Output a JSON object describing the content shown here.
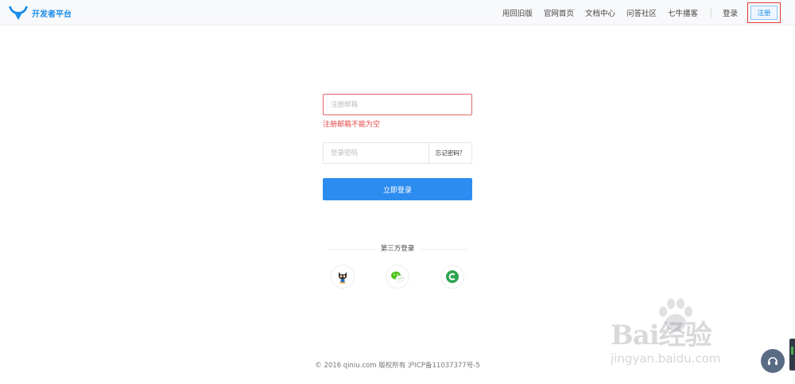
{
  "header": {
    "logo_text": "开发者平台",
    "nav": [
      {
        "label": "用回旧版"
      },
      {
        "label": "官网首页"
      },
      {
        "label": "文档中心"
      },
      {
        "label": "问答社区"
      },
      {
        "label": "七牛播客"
      }
    ],
    "login_label": "登录",
    "register_label": "注册"
  },
  "form": {
    "email_placeholder": "注册邮箱",
    "email_value": "",
    "email_error": "注册邮箱不能为空",
    "password_placeholder": "登录密码",
    "forgot_label": "忘记密码？",
    "submit_label": "立即登录"
  },
  "third_party": {
    "title": "第三方登录",
    "providers": [
      {
        "icon": "github-octocat-icon"
      },
      {
        "icon": "wechat-icon"
      },
      {
        "icon": "coding-icon"
      }
    ]
  },
  "footer": {
    "text": "© 2016 qiniu.com 版权所有 沪ICP备11037377号-5"
  },
  "watermark": {
    "brand": "Bai经验",
    "url": "jingyan.baidu.com"
  },
  "colors": {
    "primary": "#2d8cf0",
    "logo": "#1a8dea",
    "error": "#e54545",
    "highlight_outline": "#e53935"
  }
}
